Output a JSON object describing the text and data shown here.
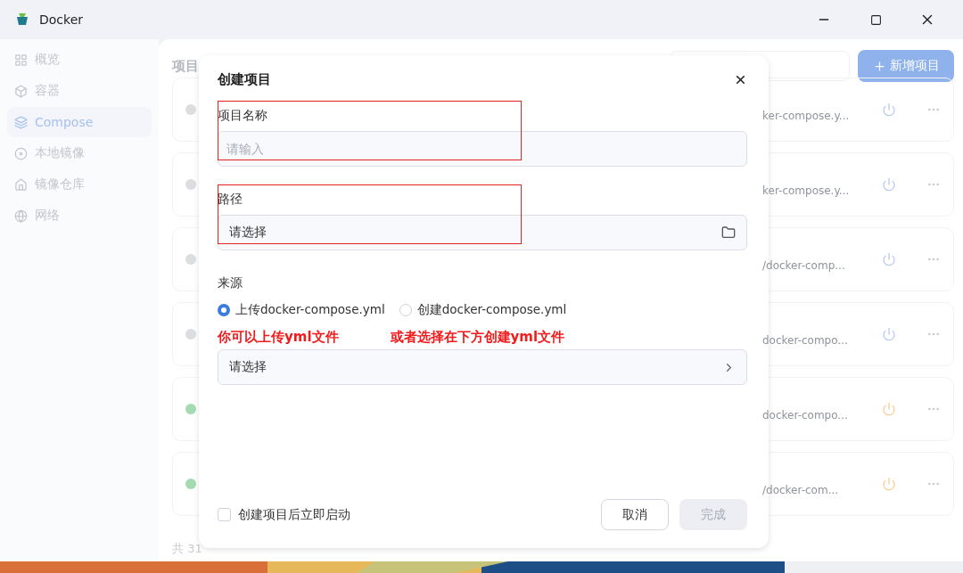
{
  "window": {
    "title": "Docker"
  },
  "sidebar": {
    "items": [
      {
        "label": "概览",
        "selected": false
      },
      {
        "label": "容器",
        "selected": false
      },
      {
        "label": "Compose",
        "selected": true
      },
      {
        "label": "本地镜像",
        "selected": false
      },
      {
        "label": "镜像仓库",
        "selected": false
      },
      {
        "label": "网络",
        "selected": false
      }
    ]
  },
  "header": {
    "title": "项目",
    "new_button": "新增项目"
  },
  "projects": [
    {
      "path": "ker-compose.y...",
      "running": false
    },
    {
      "path": "ker-compose.y...",
      "running": false
    },
    {
      "path": "/docker-comp...",
      "running": false
    },
    {
      "path": "docker-compo...",
      "running": false
    },
    {
      "path": "docker-compo...",
      "running": true
    },
    {
      "path": "/docker-com...",
      "running": true
    }
  ],
  "total": "共 31",
  "dialog": {
    "title": "创建项目",
    "fields": [
      {
        "label": "项目名称",
        "placeholder": "请输入",
        "kind": "text",
        "highlighted": true
      },
      {
        "label": "路径",
        "placeholder": "请选择",
        "kind": "folder",
        "highlighted": true
      }
    ],
    "source": {
      "label": "来源",
      "options": [
        {
          "label": "上传docker-compose.yml",
          "selected": true
        },
        {
          "label": "创建docker-compose.yml",
          "selected": false
        }
      ]
    },
    "annotations": [
      "你可以上传yml文件",
      "或者选择在下方创建yml文件"
    ],
    "picker": {
      "placeholder": "请选择"
    },
    "start_after_create": {
      "label": "创建项目后立即启动",
      "checked": false
    },
    "buttons": [
      {
        "label": "取消",
        "disabled": false
      },
      {
        "label": "完成",
        "disabled": true
      }
    ]
  }
}
